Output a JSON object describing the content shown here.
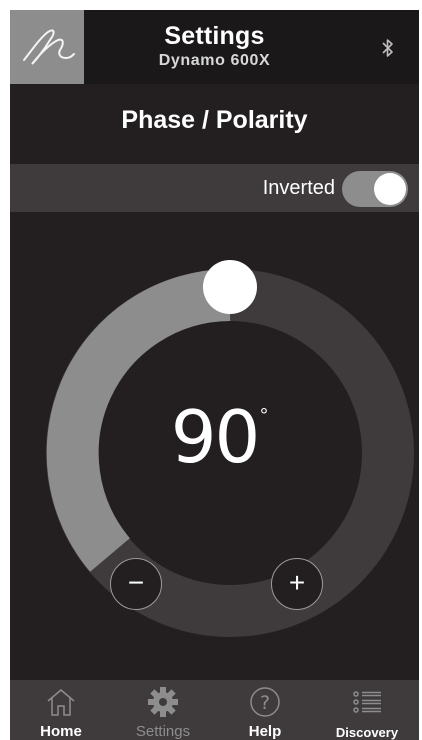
{
  "header": {
    "title": "Settings",
    "subtitle": "Dynamo 600X",
    "logo_icon": "signature-logo",
    "right_icon": "bluetooth-icon"
  },
  "section": {
    "title": "Phase / Polarity"
  },
  "inverted": {
    "label": "Inverted",
    "state": "on"
  },
  "dial": {
    "value": "90",
    "unit": "°",
    "minus_label": "−",
    "plus_label": "+",
    "knob_fraction": 0.5
  },
  "nav": {
    "items": [
      {
        "label": "Home",
        "icon": "home-icon",
        "state": "active"
      },
      {
        "label": "Settings",
        "icon": "gear-icon",
        "state": "current-dim"
      },
      {
        "label": "Help",
        "icon": "help-icon",
        "state": "active"
      },
      {
        "label": "Discovery",
        "icon": "list-icon",
        "state": "active"
      }
    ]
  },
  "colors": {
    "background": "#231f20",
    "header": "#1b1819",
    "bar": "#3f3b3c",
    "ring_light": "#8d8d8d",
    "ring_dark": "#3f3b3c",
    "accent": "#ffffff"
  }
}
